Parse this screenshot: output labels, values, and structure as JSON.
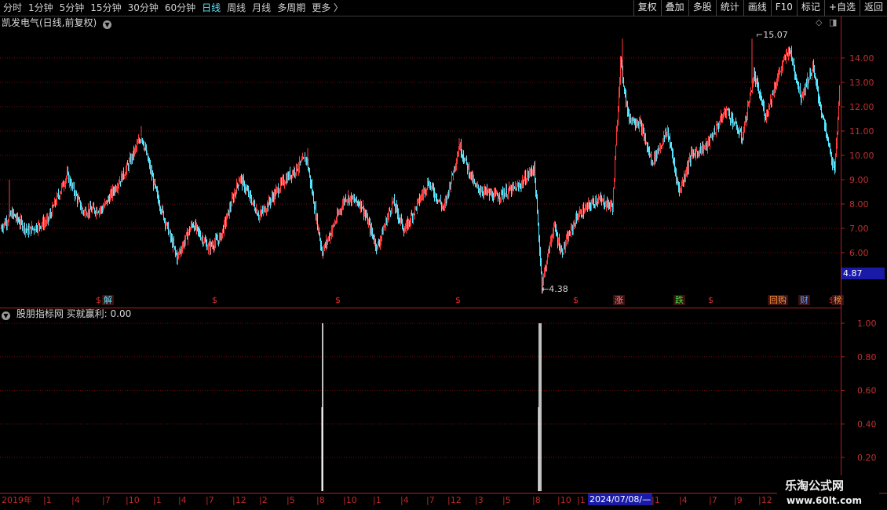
{
  "toolbar": {
    "periods": [
      "分时",
      "1分钟",
      "5分钟",
      "15分钟",
      "30分钟",
      "60分钟",
      "日线",
      "周线",
      "月线",
      "多周期",
      "更多 〉"
    ],
    "active_period": "日线",
    "right_buttons": [
      "复权",
      "叠加",
      "多股",
      "统计",
      "画线",
      "F10",
      "标记",
      "+自选",
      "返回"
    ]
  },
  "main_panel": {
    "title": "凯发电气(日线,前复权)",
    "high_label": "15.07",
    "low_label": "4.38",
    "current_price": "4.87",
    "y_ticks": [
      "14.00",
      "13.00",
      "12.00",
      "11.00",
      "10.00",
      "9.00",
      "8.00",
      "7.00",
      "6.00"
    ],
    "event_markers": [
      {
        "text": "$",
        "color": "#e03030"
      },
      {
        "text": "解",
        "color": "#5fe6ff"
      },
      {
        "text": "$",
        "color": "#e03030"
      },
      {
        "text": "$",
        "color": "#e03030"
      },
      {
        "text": "$",
        "color": "#e03030"
      },
      {
        "text": "$",
        "color": "#e03030"
      },
      {
        "text": "涨",
        "color": "#ff8080"
      },
      {
        "text": "跌",
        "color": "#40e040"
      },
      {
        "text": "$",
        "color": "#e03030"
      },
      {
        "text": "回购",
        "color": "#ff9a40"
      },
      {
        "text": "财",
        "color": "#60a0ff"
      },
      {
        "text": "$",
        "color": "#e03030"
      },
      {
        "text": "榜",
        "color": "#ff9a40"
      }
    ]
  },
  "indicator_panel": {
    "title": "股朋指标网  买就赢利: 0.00",
    "y_ticks": [
      "1.00",
      "0.80",
      "0.60",
      "0.40",
      "0.20"
    ]
  },
  "date_axis": {
    "labels": [
      "2019年",
      "1",
      "4",
      "7",
      "10",
      "1",
      "4",
      "7",
      "12",
      "2",
      "5",
      "8",
      "10",
      "1",
      "4",
      "7",
      "12",
      "3",
      "5",
      "8",
      "10",
      "1",
      "4",
      "6",
      "2024/07/08/—",
      "1",
      "4",
      "7",
      "9",
      "12"
    ],
    "cursor_date": "2024/07/08/—"
  },
  "watermark": {
    "line1": "乐淘公式网",
    "line2": "www.60lt.com"
  },
  "colors": {
    "up": "#ff3a3a",
    "down": "#54e6ff",
    "axis": "#b02020",
    "grid": "#7a1010",
    "accent": "#1a1aa8"
  }
}
